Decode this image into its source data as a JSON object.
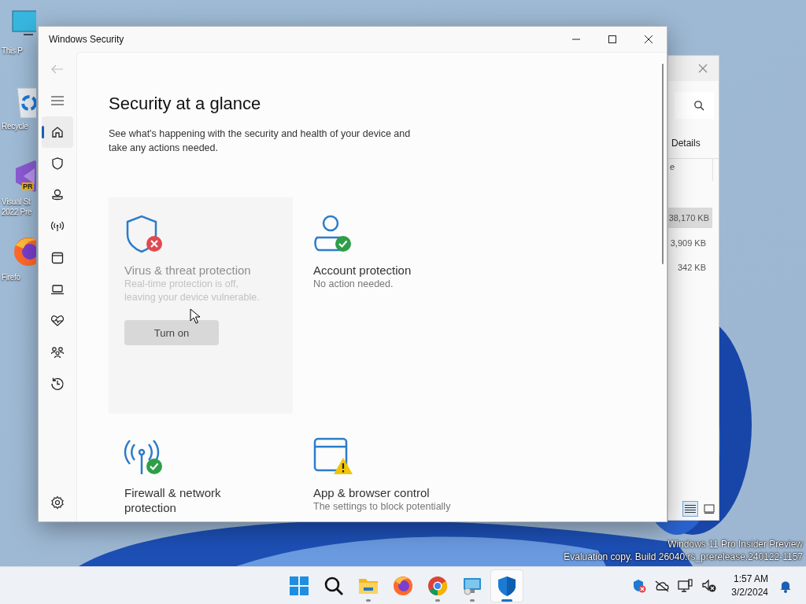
{
  "desktop_icons": [
    {
      "kind": "monitor",
      "label": "This P"
    },
    {
      "kind": "recycle",
      "label": "Recycle"
    },
    {
      "kind": "studio",
      "label": "Visual St\n2022 Pre",
      "badge": "PR"
    },
    {
      "kind": "firefox",
      "label": "Firefo"
    }
  ],
  "back_window": {
    "tabs": "Details",
    "column_1": "e",
    "rows": [
      {
        "size": "38,170 KB",
        "selected": true
      },
      {
        "size": "3,909 KB",
        "selected": false
      },
      {
        "size": "342 KB",
        "selected": false
      }
    ],
    "views": [
      {
        "kind": "details",
        "selected": true
      },
      {
        "kind": "tiles",
        "selected": false
      }
    ]
  },
  "window": {
    "title": "Windows Security",
    "back": {
      "disabled": true
    },
    "sidebar": {
      "items": [
        {
          "kind": "home",
          "selected": true
        },
        {
          "kind": "shield",
          "selected": false
        },
        {
          "kind": "person",
          "selected": false
        },
        {
          "kind": "antenna",
          "selected": false
        },
        {
          "kind": "browser",
          "selected": false
        },
        {
          "kind": "laptop",
          "selected": false
        },
        {
          "kind": "heart",
          "selected": false
        },
        {
          "kind": "family",
          "selected": false
        },
        {
          "kind": "history",
          "selected": false
        }
      ]
    },
    "heading": "Security at a glance",
    "subtitle": "See what's happening with the security and health of your device and take any actions needed.",
    "cards": [
      {
        "kind": "shield_error",
        "hovered": true,
        "title": "Virus & threat protection",
        "description": "Real-time protection is off, leaving your device vulnerable.",
        "button": "Turn on"
      },
      {
        "kind": "person_ok",
        "hovered": false,
        "title": "Account protection",
        "description": "No action needed."
      },
      {
        "kind": "antenna_ok",
        "hovered": false,
        "title": "Firewall & network protection"
      },
      {
        "kind": "browser_warning",
        "hovered": false,
        "title": "App & browser control",
        "description": "The settings to block potentially"
      }
    ]
  },
  "watermark_lines": [
    "Windows 11 Pro Insider Preview",
    "Evaluation copy. Build 26040.rs_prerelease.240122-1157"
  ],
  "taskbar": {
    "apps": [
      {
        "kind": "start",
        "running": false,
        "selected": false
      },
      {
        "kind": "search",
        "running": false,
        "selected": false
      },
      {
        "kind": "explorer",
        "running": true,
        "selected": false
      },
      {
        "kind": "firefox",
        "running": false,
        "selected": false
      },
      {
        "kind": "chrome",
        "running": true,
        "selected": false
      },
      {
        "kind": "remote",
        "running": true,
        "selected": false
      },
      {
        "kind": "security",
        "running": true,
        "selected": true
      }
    ],
    "time": "1:57 AM",
    "date": "3/2/2024"
  }
}
